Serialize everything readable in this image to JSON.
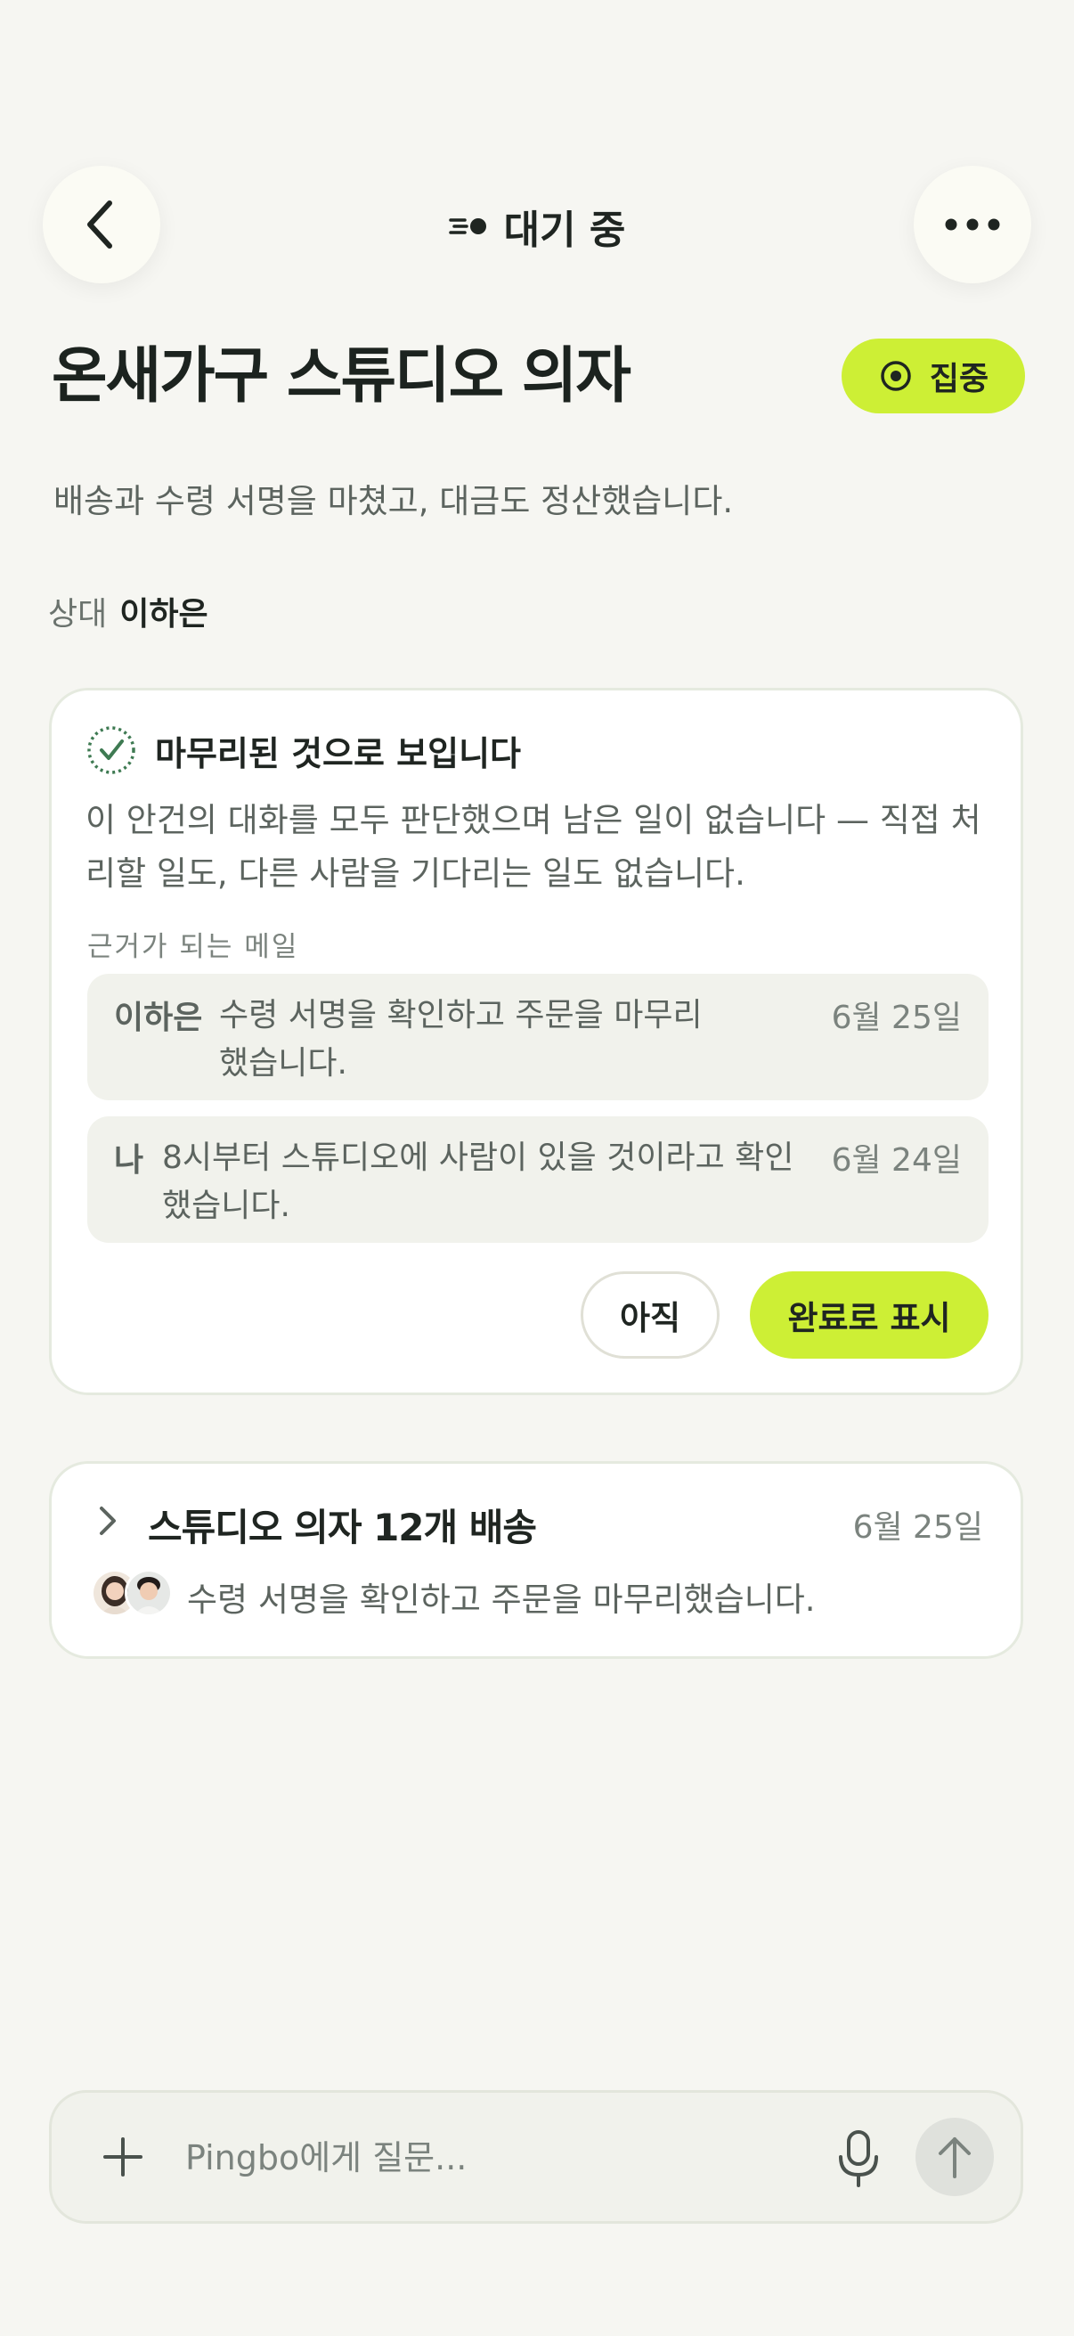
{
  "header": {
    "status_label": "대기 중",
    "back_icon": "chevron-left-icon",
    "more_icon": "ellipsis-icon",
    "status_icon": "waiting-dot-icon"
  },
  "title": "온새가구 스튜디오 의자",
  "focus_chip": {
    "label": "집중",
    "icon": "target-icon",
    "color": "#cdef35"
  },
  "summary": "배송과 수령 서명을 마쳤고, 대금도 정산했습니다.",
  "counterpart": {
    "label": "상대",
    "name": "이하은"
  },
  "completion_card": {
    "heading": "마무리된 것으로 보입니다",
    "icon": "check-circle-icon",
    "body": "이 안건의 대화를 모두 판단했으며 남은 일이 없습니다 — 직접 처리할 일도, 다른 사람을 기다리는 일도 없습니다.",
    "evidence_label": "근거가 되는 메일",
    "evidence": [
      {
        "sender": "이하은",
        "text": "수령 서명을 확인하고 주문을 마무리했습니다.",
        "line1": "수령 서명을 확인하고 주문을 마무리",
        "line2": "했습니다.",
        "date": "6월 25일"
      },
      {
        "sender": "나",
        "text": "8시부터 스튜디오에 사람이 있을 것이라고 확인했습니다.",
        "line1": "8시부터 스튜디오에 사람이 있을 것이라고 확인",
        "line2": "했습니다.",
        "date": "6월 24일"
      }
    ],
    "not_yet_label": "아직",
    "mark_done_label": "완료로 표시"
  },
  "thread": {
    "title": "스튜디오 의자 12개 배송",
    "date": "6월 25일",
    "preview": "수령 서명을 확인하고 주문을 마무리했습니다.",
    "icon": "chevron-right-icon",
    "avatars": [
      "avatar-woman",
      "avatar-man"
    ]
  },
  "composer": {
    "placeholder": "Pingbo에게 질문...",
    "value": "",
    "plus_icon": "plus-icon",
    "mic_icon": "microphone-icon",
    "send_icon": "arrow-up-icon"
  }
}
